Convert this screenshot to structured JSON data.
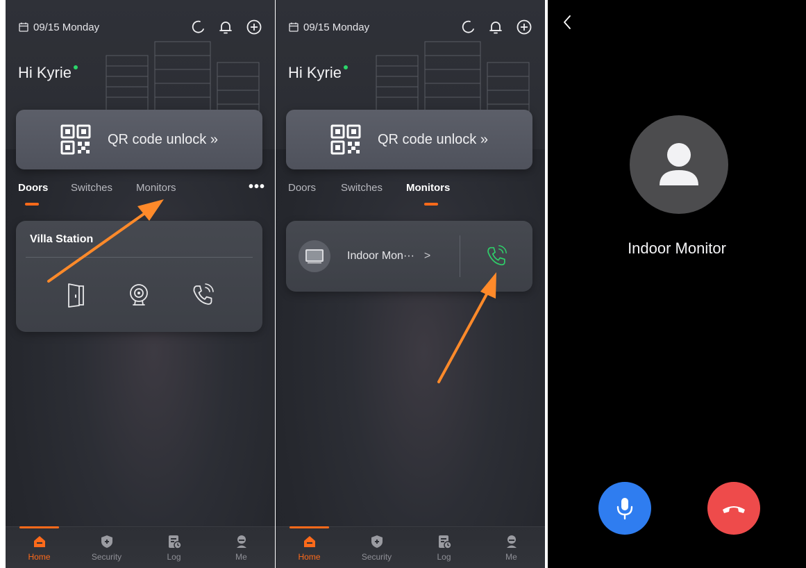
{
  "status": {
    "date": "09/15 Monday"
  },
  "greeting": {
    "text": "Hi Kyrie"
  },
  "qr": {
    "label": "QR code unlock »"
  },
  "tabs": {
    "doors": "Doors",
    "switches": "Switches",
    "monitors": "Monitors",
    "more": "•••"
  },
  "villa": {
    "title": "Villa Station"
  },
  "monitor_item": {
    "label": "Indoor Mon···",
    "chevron": ">"
  },
  "nav": {
    "home": "Home",
    "security": "Security",
    "log": "Log",
    "me": "Me"
  },
  "call": {
    "name": "Indoor Monitor",
    "back": "<"
  },
  "colors": {
    "accent": "#ff6a1a",
    "online": "#2bd66a",
    "call_green": "#2fcf6a",
    "mic_blue": "#2f7df0",
    "hangup_red": "#ee4b4b",
    "arrow": "#ff8a2a"
  }
}
